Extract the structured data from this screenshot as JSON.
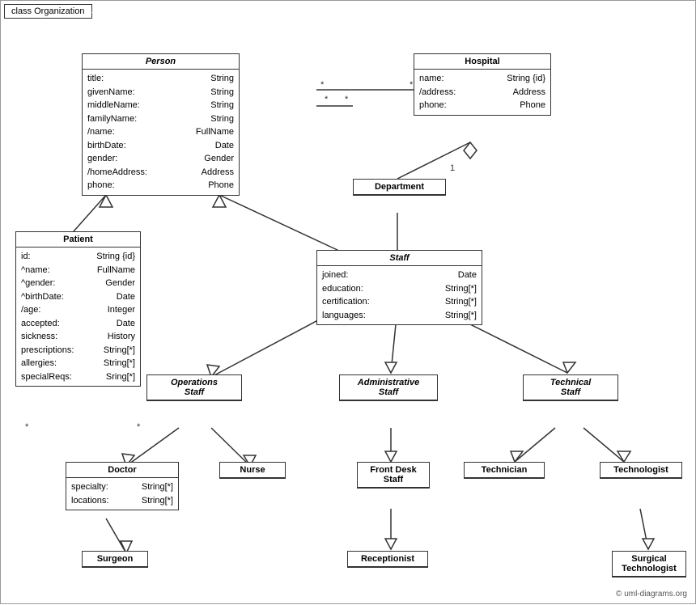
{
  "title": "class Organization",
  "copyright": "© uml-diagrams.org",
  "classes": {
    "person": {
      "name": "Person",
      "italic": true,
      "attrs": [
        {
          "name": "title:",
          "type": "String"
        },
        {
          "name": "givenName:",
          "type": "String"
        },
        {
          "name": "middleName:",
          "type": "String"
        },
        {
          "name": "familyName:",
          "type": "String"
        },
        {
          "name": "/name:",
          "type": "FullName"
        },
        {
          "name": "birthDate:",
          "type": "Date"
        },
        {
          "name": "gender:",
          "type": "Gender"
        },
        {
          "name": "/homeAddress:",
          "type": "Address"
        },
        {
          "name": "phone:",
          "type": "Phone"
        }
      ]
    },
    "hospital": {
      "name": "Hospital",
      "italic": false,
      "attrs": [
        {
          "name": "name:",
          "type": "String {id}"
        },
        {
          "name": "/address:",
          "type": "Address"
        },
        {
          "name": "phone:",
          "type": "Phone"
        }
      ]
    },
    "department": {
      "name": "Department",
      "italic": false,
      "attrs": []
    },
    "staff": {
      "name": "Staff",
      "italic": true,
      "attrs": [
        {
          "name": "joined:",
          "type": "Date"
        },
        {
          "name": "education:",
          "type": "String[*]"
        },
        {
          "name": "certification:",
          "type": "String[*]"
        },
        {
          "name": "languages:",
          "type": "String[*]"
        }
      ]
    },
    "patient": {
      "name": "Patient",
      "italic": false,
      "attrs": [
        {
          "name": "id:",
          "type": "String {id}"
        },
        {
          "name": "^name:",
          "type": "FullName"
        },
        {
          "name": "^gender:",
          "type": "Gender"
        },
        {
          "name": "^birthDate:",
          "type": "Date"
        },
        {
          "name": "/age:",
          "type": "Integer"
        },
        {
          "name": "accepted:",
          "type": "Date"
        },
        {
          "name": "sickness:",
          "type": "History"
        },
        {
          "name": "prescriptions:",
          "type": "String[*]"
        },
        {
          "name": "allergies:",
          "type": "String[*]"
        },
        {
          "name": "specialReqs:",
          "type": "Sring[*]"
        }
      ]
    },
    "operations_staff": {
      "name": "Operations Staff",
      "italic": true
    },
    "administrative_staff": {
      "name": "Administrative Staff",
      "italic": true
    },
    "technical_staff": {
      "name": "Technical Staff",
      "italic": true
    },
    "doctor": {
      "name": "Doctor",
      "italic": false,
      "attrs": [
        {
          "name": "specialty:",
          "type": "String[*]"
        },
        {
          "name": "locations:",
          "type": "String[*]"
        }
      ]
    },
    "nurse": {
      "name": "Nurse",
      "italic": false,
      "attrs": []
    },
    "front_desk_staff": {
      "name": "Front Desk Staff",
      "italic": false,
      "attrs": []
    },
    "technician": {
      "name": "Technician",
      "italic": false,
      "attrs": []
    },
    "technologist": {
      "name": "Technologist",
      "italic": false,
      "attrs": []
    },
    "surgeon": {
      "name": "Surgeon",
      "italic": false,
      "attrs": []
    },
    "receptionist": {
      "name": "Receptionist",
      "italic": false,
      "attrs": []
    },
    "surgical_technologist": {
      "name": "Surgical Technologist",
      "italic": false,
      "attrs": []
    }
  }
}
